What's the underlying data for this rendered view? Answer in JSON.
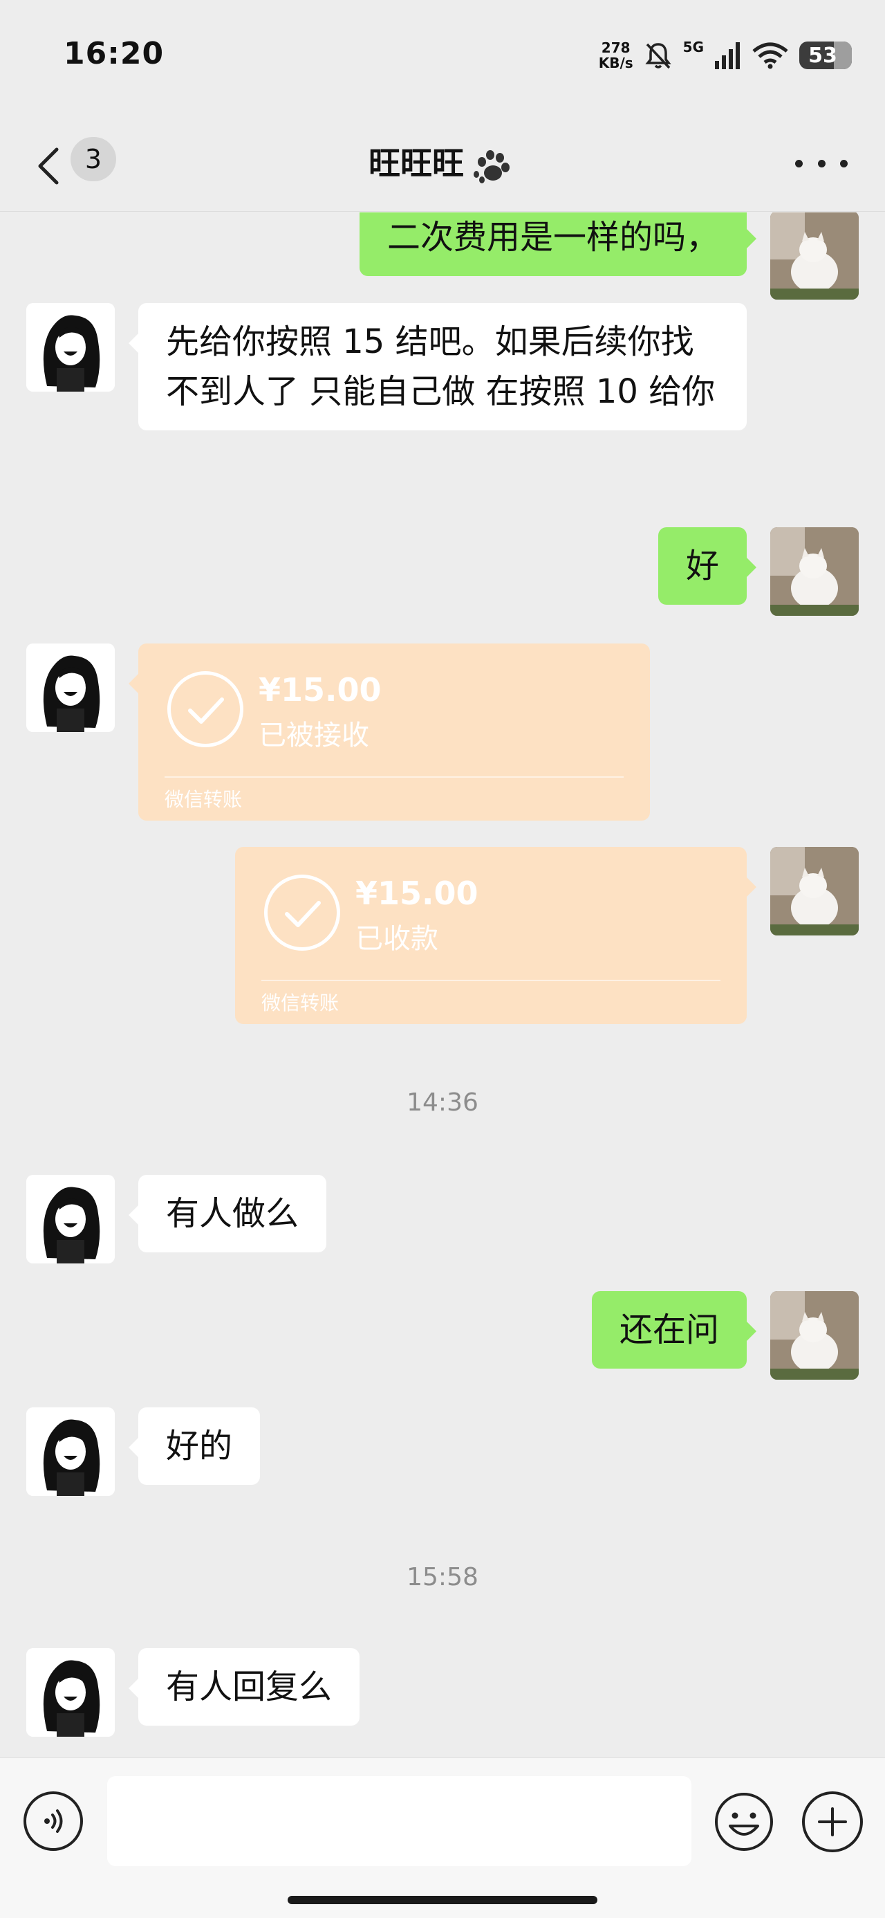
{
  "status_bar": {
    "time": "16:20",
    "net_speed_value": "278",
    "net_speed_unit": "KB/s",
    "network": "5G",
    "battery": "53"
  },
  "nav": {
    "unread_count": "3",
    "title": "旺旺旺"
  },
  "messages": [
    {
      "side": "right",
      "text": "二次费用是一样的吗，"
    },
    {
      "side": "left",
      "text": "先给你按照 15 结吧。如果后续你找不到人了 只能自己做 在按照 10 给你"
    },
    {
      "side": "right",
      "text": "好"
    },
    {
      "side": "left",
      "type": "transfer",
      "amount": "¥15.00",
      "status": "已被接收",
      "footer": "微信转账"
    },
    {
      "side": "right",
      "type": "transfer",
      "amount": "¥15.00",
      "status": "已收款",
      "footer": "微信转账"
    },
    {
      "type": "time",
      "text": "14:36"
    },
    {
      "side": "left",
      "text": "有人做么"
    },
    {
      "side": "right",
      "text": "还在问"
    },
    {
      "side": "left",
      "text": "好的"
    },
    {
      "type": "time",
      "text": "15:58"
    },
    {
      "side": "left",
      "text": "有人回复么"
    }
  ],
  "input": {
    "value": ""
  }
}
